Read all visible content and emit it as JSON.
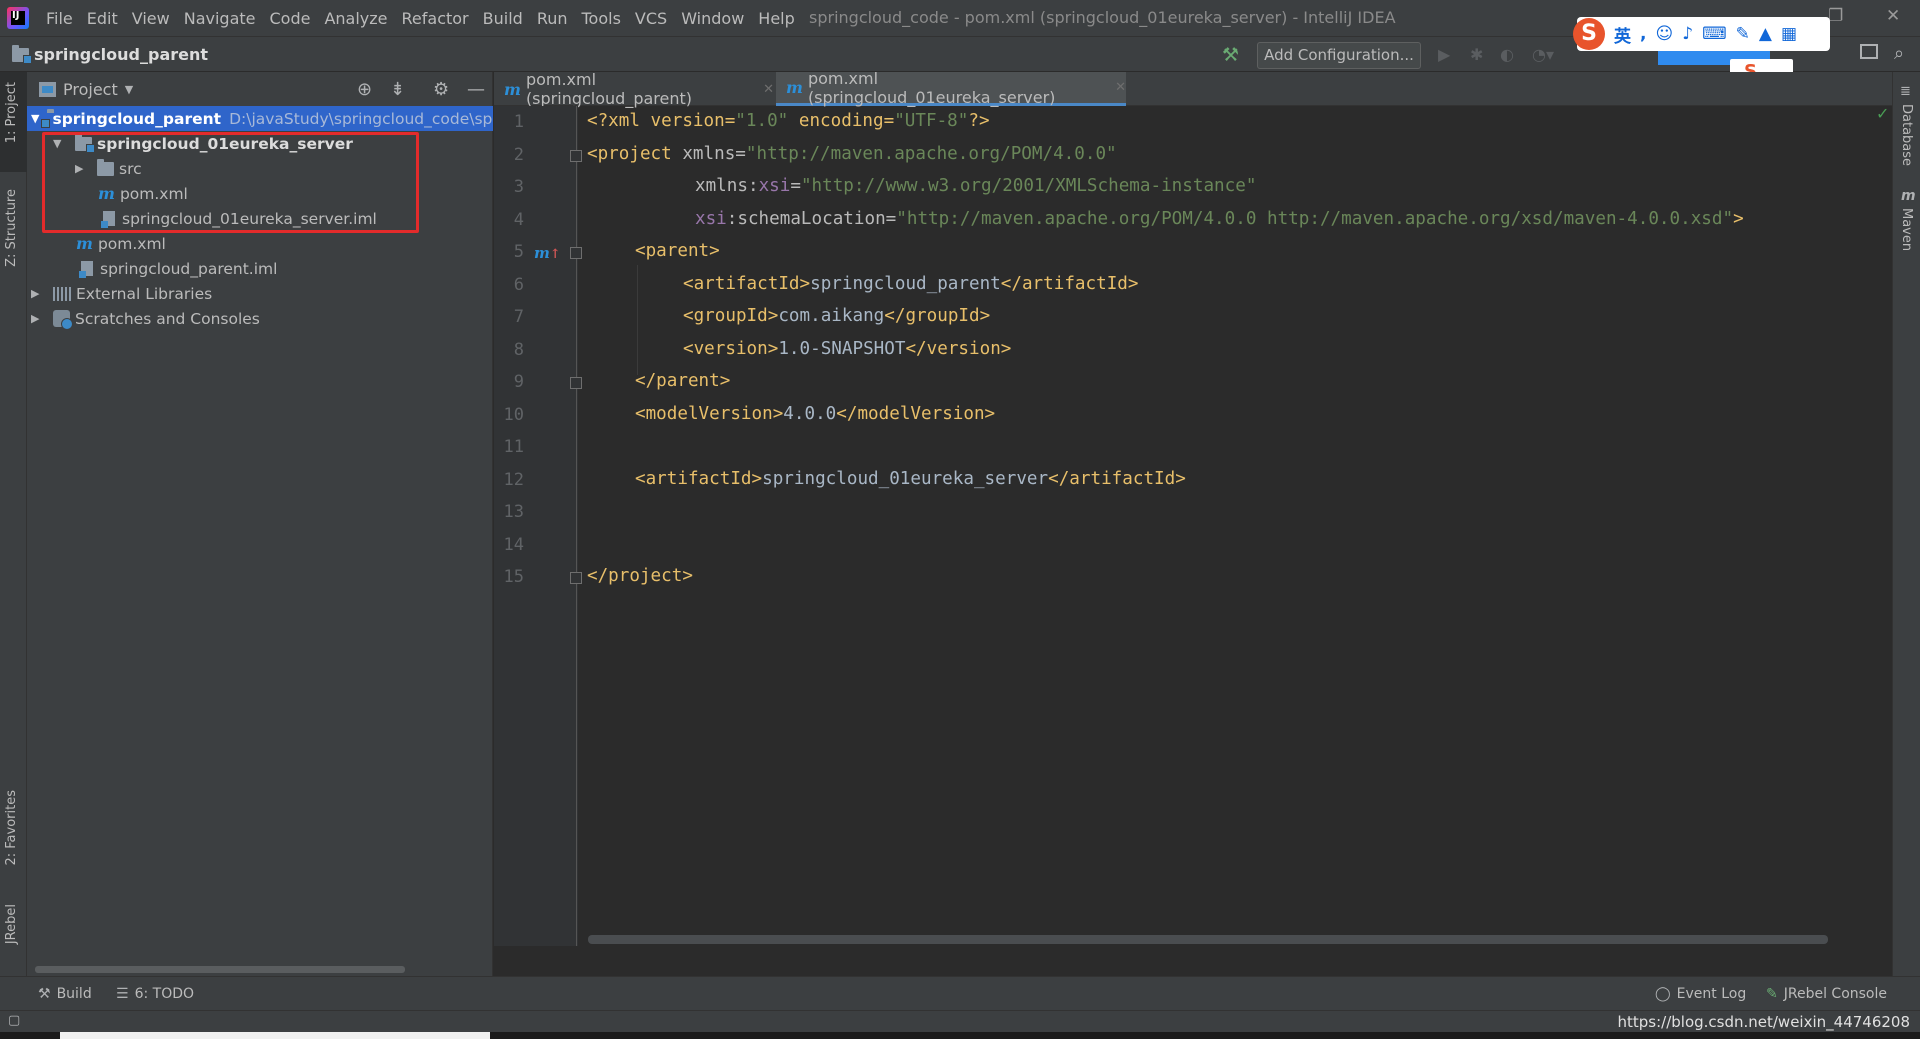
{
  "app": {
    "window_title": "springcloud_code - pom.xml (springcloud_01eureka_server) - IntelliJ IDEA",
    "logo_letters": "IJ"
  },
  "menu": [
    "File",
    "Edit",
    "View",
    "Navigate",
    "Code",
    "Analyze",
    "Refactor",
    "Build",
    "Run",
    "Tools",
    "VCS",
    "Window",
    "Help"
  ],
  "navbar": {
    "breadcrumb": "springcloud_parent",
    "add_configuration": "Add Configuration..."
  },
  "ime": {
    "logo": "S",
    "lang": "英"
  },
  "left_stripe": {
    "project": "1: Project",
    "structure": "Z: Structure",
    "favorites": "2: Favorites",
    "jrebel": "JRebel"
  },
  "project_panel": {
    "title": "Project",
    "tree": [
      {
        "label": "springcloud_parent",
        "path": "D:\\javaStudy\\springcloud_code\\spri"
      },
      {
        "label": "springcloud_01eureka_server"
      },
      {
        "label": "src"
      },
      {
        "label": "pom.xml"
      },
      {
        "label": "springcloud_01eureka_server.iml"
      },
      {
        "label": "pom.xml"
      },
      {
        "label": "springcloud_parent.iml"
      },
      {
        "label": "External Libraries"
      },
      {
        "label": "Scratches and Consoles"
      }
    ]
  },
  "editor": {
    "tabs": [
      {
        "label": "pom.xml (springcloud_parent)"
      },
      {
        "label": "pom.xml (springcloud_01eureka_server)"
      }
    ],
    "line_numbers": [
      "1",
      "2",
      "3",
      "4",
      "5",
      "6",
      "7",
      "8",
      "9",
      "10",
      "11",
      "12",
      "13",
      "14",
      "15"
    ],
    "lines": {
      "l1": [
        "<?xml version=",
        "\"1.0\"",
        " encoding=",
        "\"UTF-8\"",
        "?>"
      ],
      "l2": [
        "<project",
        " xmlns=",
        "\"http://maven.apache.org/POM/4.0.0\""
      ],
      "l3": [
        "xmlns:",
        "xsi",
        "=",
        "\"http://www.w3.org/2001/XMLSchema-instance\""
      ],
      "l4": [
        "xsi",
        ":schemaLocation=",
        "\"http://maven.apache.org/POM/4.0.0 http://maven.apache.org/xsd/maven-4.0.0.xsd\"",
        ">"
      ],
      "l5": [
        "<parent>"
      ],
      "l6": [
        "<artifactId>",
        "springcloud_parent",
        "</artifactId>"
      ],
      "l7": [
        "<groupId>",
        "com.aikang",
        "</groupId>"
      ],
      "l8": [
        "<version>",
        "1.0-SNAPSHOT",
        "</version>"
      ],
      "l9": [
        "</parent>"
      ],
      "l10": [
        "<modelVersion>",
        "4.0.0",
        "</modelVersion>"
      ],
      "l12": [
        "<artifactId>",
        "springcloud_01eureka_server",
        "</artifactId>"
      ],
      "l15": [
        "</project>"
      ]
    },
    "gutter_marker": "m"
  },
  "right_stripe": {
    "database": "Database",
    "maven": "Maven"
  },
  "bottom_tools": {
    "build": "Build",
    "todo": "6: TODO",
    "event_log": "Event Log",
    "jrebel_console": "JRebel Console"
  },
  "status": {
    "watermark": "https://blog.csdn.net/weixin_44746208"
  },
  "colors": {
    "selection": "#2f65ca",
    "highlight_box": "#e32b2b",
    "xml_tag": "#e8bf6a",
    "xml_string": "#6a8759",
    "namespace": "#9876aa"
  }
}
